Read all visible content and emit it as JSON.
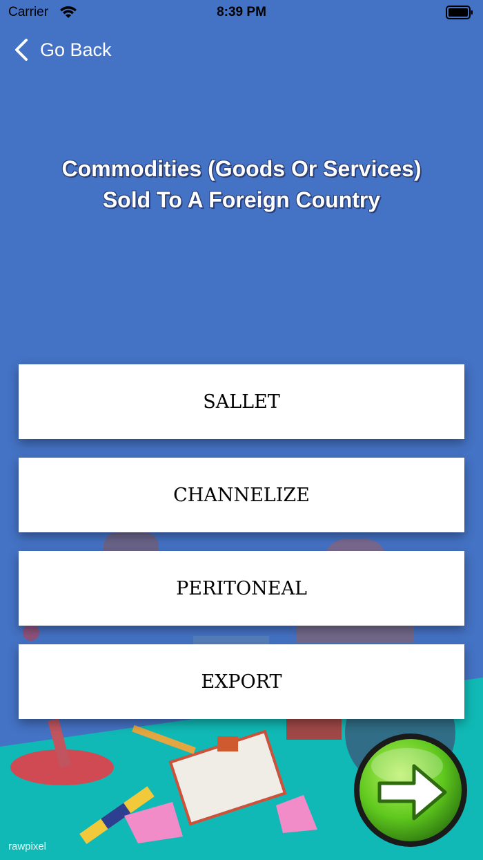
{
  "status_bar": {
    "carrier": "Carrier",
    "time": "8:39 PM"
  },
  "nav": {
    "back_label": "Go Back"
  },
  "question": {
    "line1": "Commodities (Goods Or Services)",
    "line2": "Sold To A Foreign Country"
  },
  "answers": [
    {
      "label": "SALLET"
    },
    {
      "label": "CHANNELIZE"
    },
    {
      "label": "PERITONEAL"
    },
    {
      "label": "EXPORT"
    }
  ],
  "next": {
    "icon": "arrow-right-icon"
  },
  "watermark": {
    "text": "rawpixel"
  },
  "colors": {
    "background": "#4472c4",
    "answer_bg": "#ffffff",
    "next_button": "#5fc81e",
    "floor": "#10b9b5"
  }
}
